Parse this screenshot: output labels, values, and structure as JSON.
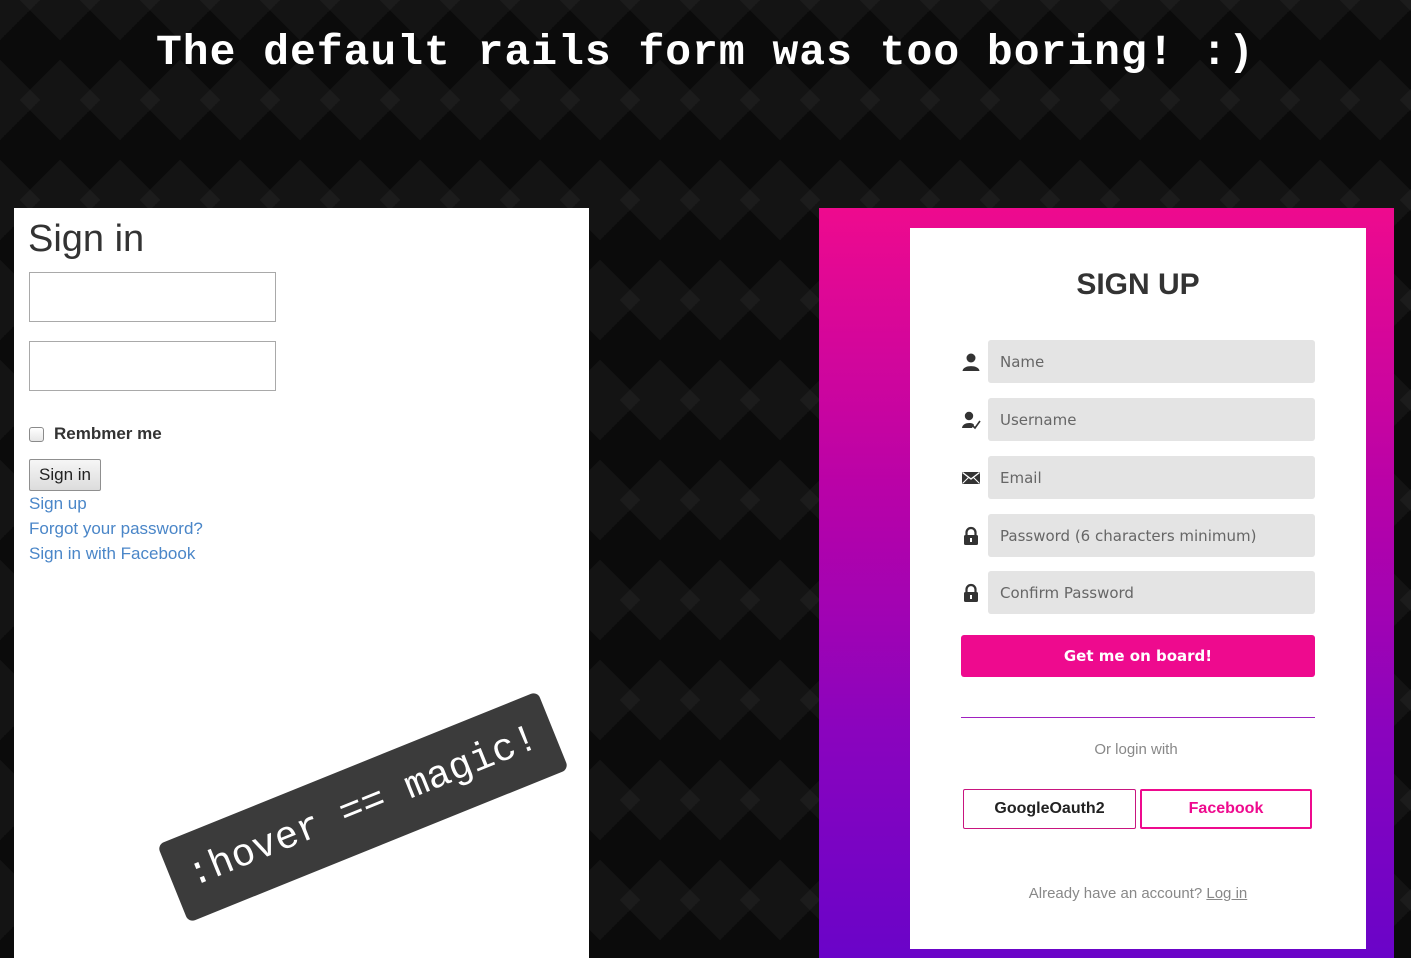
{
  "headline": "The default rails form was too boring! :)",
  "left_form": {
    "title": "Sign in",
    "remember_label": "Rembmer me",
    "submit_label": "Sign in",
    "links": [
      "Sign up",
      "Forgot your password?",
      "Sign in with Facebook"
    ]
  },
  "badge": ":hover == magic!",
  "signup": {
    "title": "SIGN UP",
    "fields": [
      {
        "placeholder": "Name",
        "icon": "user-icon"
      },
      {
        "placeholder": "Username",
        "icon": "user-check-icon"
      },
      {
        "placeholder": "Email",
        "icon": "envelope-icon"
      },
      {
        "placeholder": "Password (6 characters minimum)",
        "icon": "lock-icon"
      },
      {
        "placeholder": "Confirm Password",
        "icon": "lock-icon"
      }
    ],
    "submit_label": "Get me on board!",
    "or_login": "Or login with",
    "google_label": "GoogleOauth2",
    "facebook_label": "Facebook",
    "already_text": "Already have an account?",
    "login_link": "Log in"
  },
  "colors": {
    "accent": "#ee0a8e",
    "gradient_top": "#ee0a8e",
    "gradient_bottom": "#6a04c8",
    "link": "#4a86c8"
  }
}
